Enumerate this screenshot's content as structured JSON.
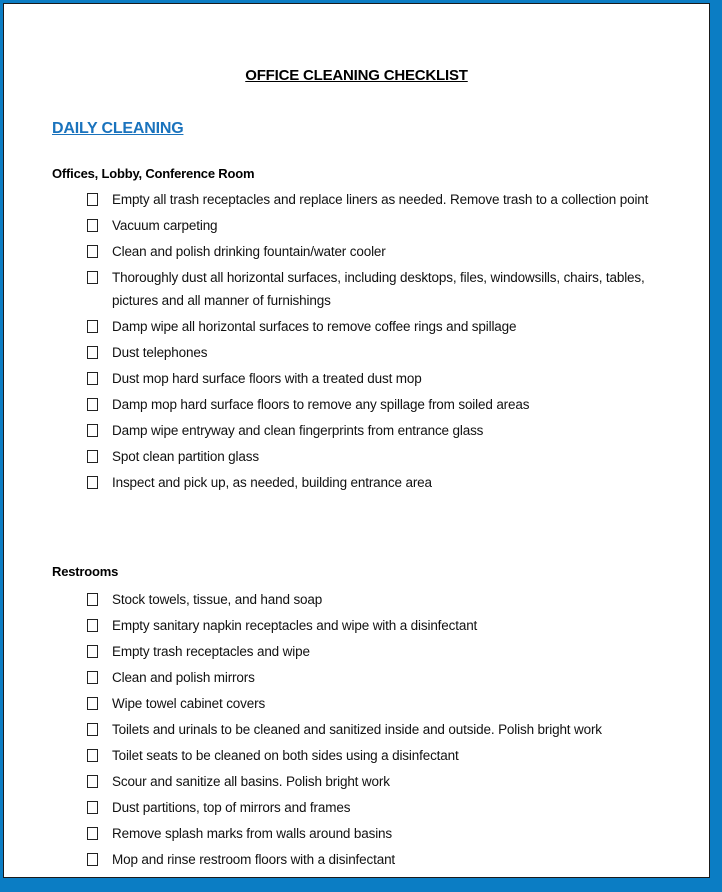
{
  "document": {
    "title": "OFFICE CLEANING CHECKLIST",
    "frame_color": "#0b7dc4",
    "heading_color": "#1a73bd",
    "sections": [
      {
        "heading": "DAILY CLEANING",
        "groups": [
          {
            "title": "Offices, Lobby, Conference Room",
            "items": [
              {
                "label": "Empty all trash receptacles and replace liners as needed. Remove trash to a collection point",
                "checked": false
              },
              {
                "label": "Vacuum carpeting",
                "checked": false
              },
              {
                "label": "Clean and polish drinking fountain/water cooler",
                "checked": false
              },
              {
                "label": "Thoroughly dust all horizontal surfaces, including desktops, files, windowsills, chairs, tables, pictures and all manner of furnishings",
                "checked": false
              },
              {
                "label": "Damp wipe all horizontal surfaces to remove coffee rings and spillage",
                "checked": false
              },
              {
                "label": "Dust telephones",
                "checked": false
              },
              {
                "label": "Dust mop hard surface floors with a treated dust mop",
                "checked": false
              },
              {
                "label": "Damp mop hard surface floors to remove any spillage from soiled areas",
                "checked": false
              },
              {
                "label": "Damp wipe entryway and clean fingerprints from entrance glass",
                "checked": false
              },
              {
                "label": "Spot clean partition glass",
                "checked": false
              },
              {
                "label": "Inspect and pick up, as needed, building entrance area",
                "checked": false
              }
            ]
          },
          {
            "title": "Restrooms",
            "items": [
              {
                "label": "Stock towels, tissue, and hand soap",
                "checked": false
              },
              {
                "label": "Empty sanitary napkin receptacles and wipe with a disinfectant",
                "checked": false
              },
              {
                "label": "Empty trash receptacles and wipe",
                "checked": false
              },
              {
                "label": "Clean and polish mirrors",
                "checked": false
              },
              {
                "label": "Wipe towel cabinet covers",
                "checked": false
              },
              {
                "label": "Toilets and urinals to be cleaned and sanitized inside and outside. Polish bright work",
                "checked": false
              },
              {
                "label": "Toilet seats to be cleaned on both sides using a disinfectant",
                "checked": false
              },
              {
                "label": "Scour and sanitize all basins.  Polish bright work",
                "checked": false
              },
              {
                "label": "Dust partitions, top of mirrors and frames",
                "checked": false
              },
              {
                "label": "Remove splash marks from walls around basins",
                "checked": false
              },
              {
                "label": "Mop and rinse restroom floors with a disinfectant",
                "checked": false
              }
            ]
          }
        ]
      }
    ]
  }
}
